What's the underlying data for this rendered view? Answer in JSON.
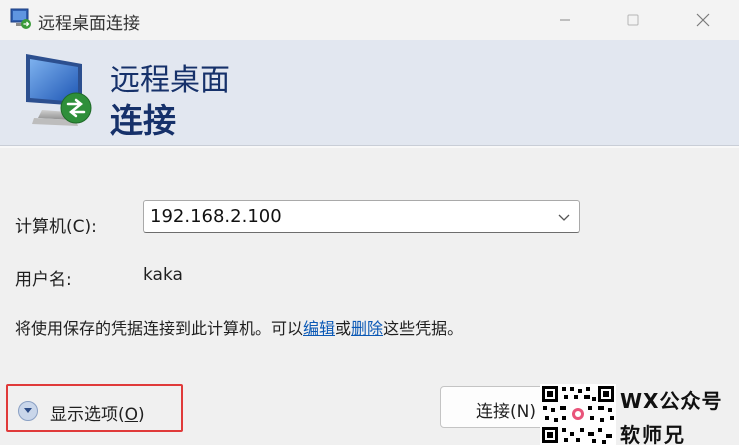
{
  "window": {
    "title": "远程桌面连接",
    "controls": {
      "minimize": "minimize-icon",
      "maximize": "maximize-icon",
      "close": "close-icon"
    }
  },
  "banner": {
    "line1": "远程桌面",
    "line2": "连接",
    "icon": "remote-desktop-monitor-icon"
  },
  "form": {
    "computer_label": "计算机(C):",
    "computer_value": "192.168.2.100",
    "user_label": "用户名:",
    "user_value": "kaka"
  },
  "info": {
    "prefix": "将使用保存的凭据连接到此计算机。可以",
    "edit_link": "编辑",
    "middle": "或",
    "delete_link": "删除",
    "suffix": "这些凭据。"
  },
  "actions": {
    "show_options_prefix": "显示选项(",
    "show_options_key": "O",
    "show_options_suffix": ")",
    "connect_label": "连接(N)"
  },
  "watermark": {
    "line1": "WX公众号",
    "line2": "软师兄"
  },
  "colors": {
    "banner_bg": "#e2e7f0",
    "banner_text": "#16316a",
    "link": "#0a58b5",
    "highlight_box": "#e03a3a"
  }
}
